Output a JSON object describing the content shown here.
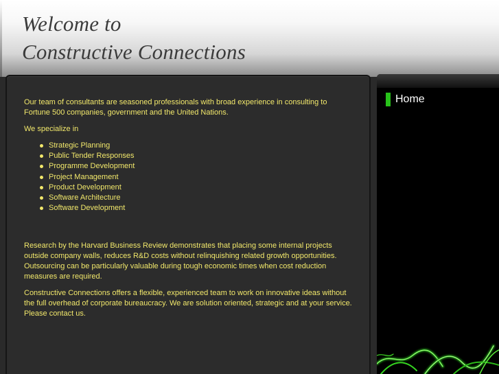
{
  "header": {
    "title_line1": "Welcome to",
    "title_line2": "Constructive Connections"
  },
  "nav": {
    "items": [
      {
        "label": "Home"
      }
    ]
  },
  "main": {
    "intro": "Our team of consultants are seasoned professionals with broad experience in consulting to Fortune 500 companies, government and the United Nations.",
    "specialize_label": "We specialize in",
    "services": [
      "Strategic Planning",
      "Public Tender Responses",
      "Programme Development",
      "Project Management",
      "Product Development",
      "Software Architecture",
      "Software Development"
    ],
    "research": "Research by the Harvard Business Review demonstrates that placing some internal projects outside company walls, reduces R&D costs without relinquishing related growth opportunities. Outsourcing can be particularly valuable during tough economic times when cost reduction measures are required.",
    "offer": "Constructive Connections offers a flexible, experienced team to work on innovative ideas without the full overhead of corporate bureaucracy. We are solution oriented, strategic and at your service. Please contact us."
  },
  "colors": {
    "text": "#f2e86b",
    "accent": "#27c11a",
    "content_bg": "#2c2c2c",
    "sidebar_bg": "#000000"
  }
}
